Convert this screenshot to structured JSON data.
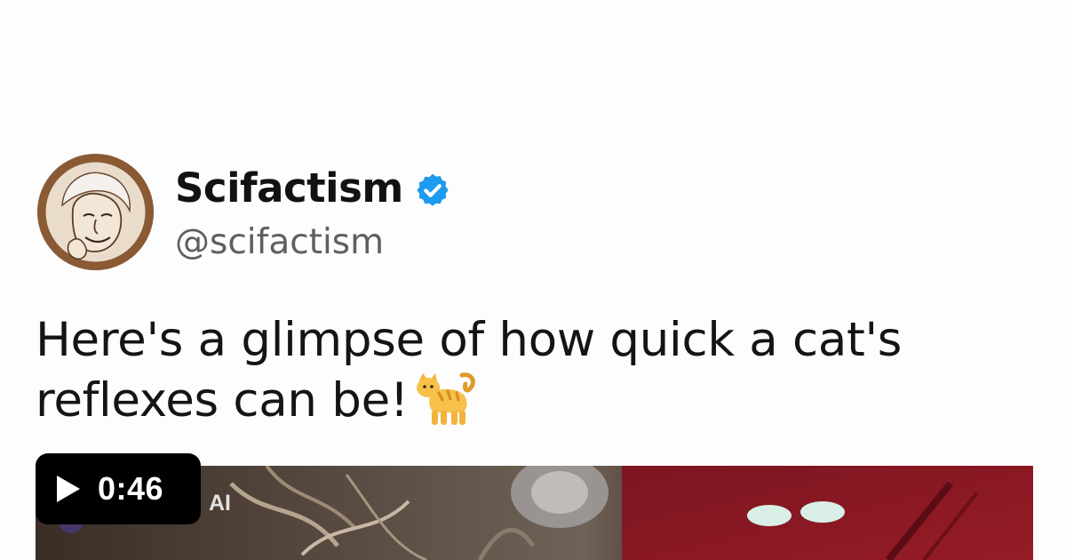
{
  "post": {
    "author_name": "Scifactism",
    "author_handle": "@scifactism",
    "verified": true,
    "text": "Here's a glimpse of how quick a cat's reflexes can be!",
    "emoji": "cat-emoji"
  },
  "video": {
    "watermark_text": "AI",
    "duration": "0:46",
    "play_icon": "play-icon"
  },
  "colors": {
    "verified_badge": "#1d9bf0",
    "badge_background": "#000000",
    "avatar_background": "#8a5a35"
  }
}
